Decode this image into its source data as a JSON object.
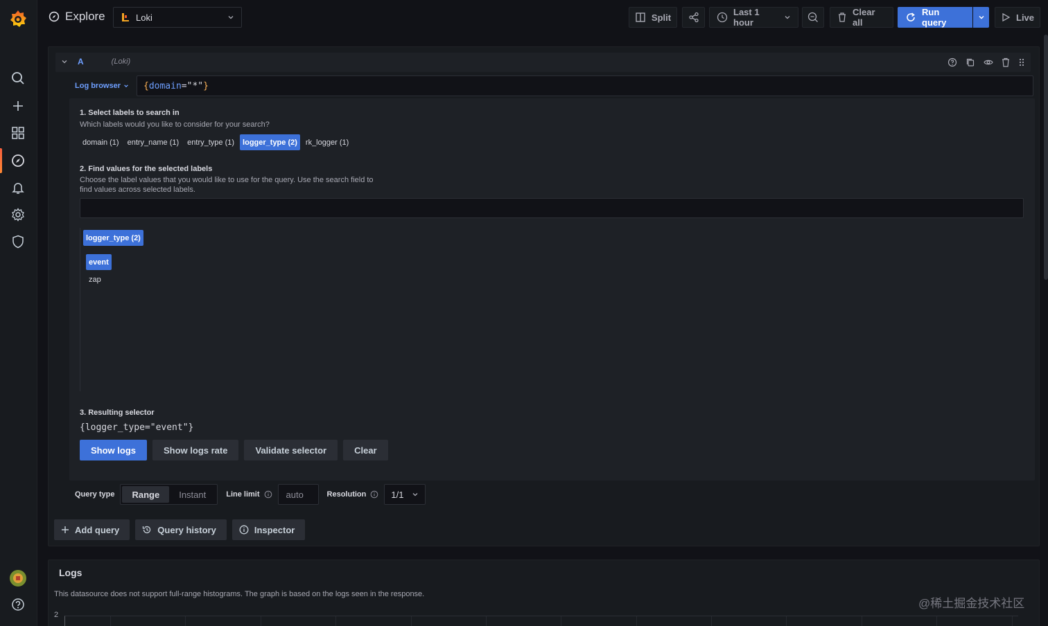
{
  "topbar": {
    "title": "Explore",
    "datasource": "Loki",
    "split_label": "Split",
    "time_range": "Last 1 hour",
    "clear_all_label": "Clear all",
    "run_query_label": "Run query",
    "live_label": "Live"
  },
  "query": {
    "ref_id": "A",
    "datasource_name": "(Loki)",
    "log_browser_label": "Log browser",
    "expr": {
      "open": "{",
      "label": "domain",
      "eq": "=",
      "value": "\"*\"",
      "close": "}"
    }
  },
  "browser": {
    "step1_title": "1. Select labels to search in",
    "step1_desc": "Which labels would you like to consider for your search?",
    "labels": [
      {
        "text": "domain (1)",
        "selected": false
      },
      {
        "text": "entry_name (1)",
        "selected": false
      },
      {
        "text": "entry_type (1)",
        "selected": false
      },
      {
        "text": "logger_type (2)",
        "selected": true
      },
      {
        "text": "rk_logger (1)",
        "selected": false
      }
    ],
    "step2_title": "2. Find values for the selected labels",
    "step2_desc_line1": "Choose the label values that you would like to use for the query. Use the search field to",
    "step2_desc_line2": "find values across selected labels.",
    "value_group_label": "logger_type (2)",
    "values": [
      {
        "text": "event",
        "selected": true
      },
      {
        "text": "zap",
        "selected": false
      }
    ],
    "step3_title": "3. Resulting selector",
    "selector": "{logger_type=\"event\"}",
    "show_logs": "Show logs",
    "show_logs_rate": "Show logs rate",
    "validate_selector": "Validate selector",
    "clear": "Clear"
  },
  "options": {
    "query_type_label": "Query type",
    "range": "Range",
    "instant": "Instant",
    "line_limit_label": "Line limit",
    "line_limit_placeholder": "auto",
    "resolution_label": "Resolution",
    "resolution_value": "1/1"
  },
  "actions": {
    "add_query": "Add query",
    "query_history": "Query history",
    "inspector": "Inspector"
  },
  "logs": {
    "title": "Logs",
    "note": "This datasource does not support full-range histograms. The graph is based on the logs seen in the response.",
    "y_tick": "2"
  },
  "watermark": "@稀土掘金技术社区",
  "colors": {
    "accent": "#3d71d9",
    "link": "#6e9fff",
    "brand": "#f55f3e",
    "background": "#111217",
    "panel": "#181b1f"
  }
}
